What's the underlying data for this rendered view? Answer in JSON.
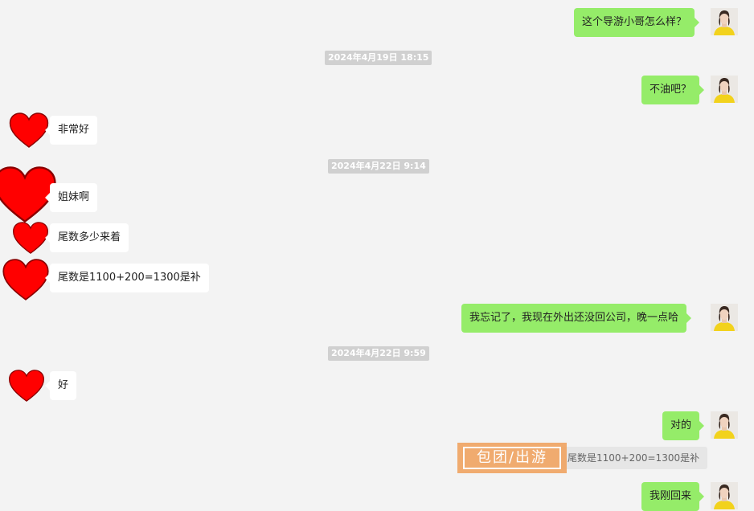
{
  "messages": {
    "m1": "这个导游小哥怎么样？",
    "t1": "2024年4月19日 18:15",
    "m2": "不油吧？",
    "m3": "非常好",
    "t2": "2024年4月22日 9:14",
    "m4": "姐妹啊",
    "m5": "尾数多少来着",
    "m6": "尾数是1100+200=1300是补",
    "m7": "我忘记了，我现在外出还没回公司，晚一点哈",
    "t3": "2024年4月22日 9:59",
    "m8": "好",
    "m9": "对的",
    "quote": "尾数是1100+200=1300是补",
    "m10": "我刚回来"
  },
  "watermark": "包团/出游",
  "icons": {
    "other_avatar": "red-heart-icon",
    "self_avatar": "woman-yellow-shirt-avatar"
  },
  "colors": {
    "background": "#f3f3f3",
    "self_bubble": "#95ec69",
    "other_bubble": "#ffffff",
    "heart": "#ff0000",
    "watermark": "#f0a564"
  }
}
